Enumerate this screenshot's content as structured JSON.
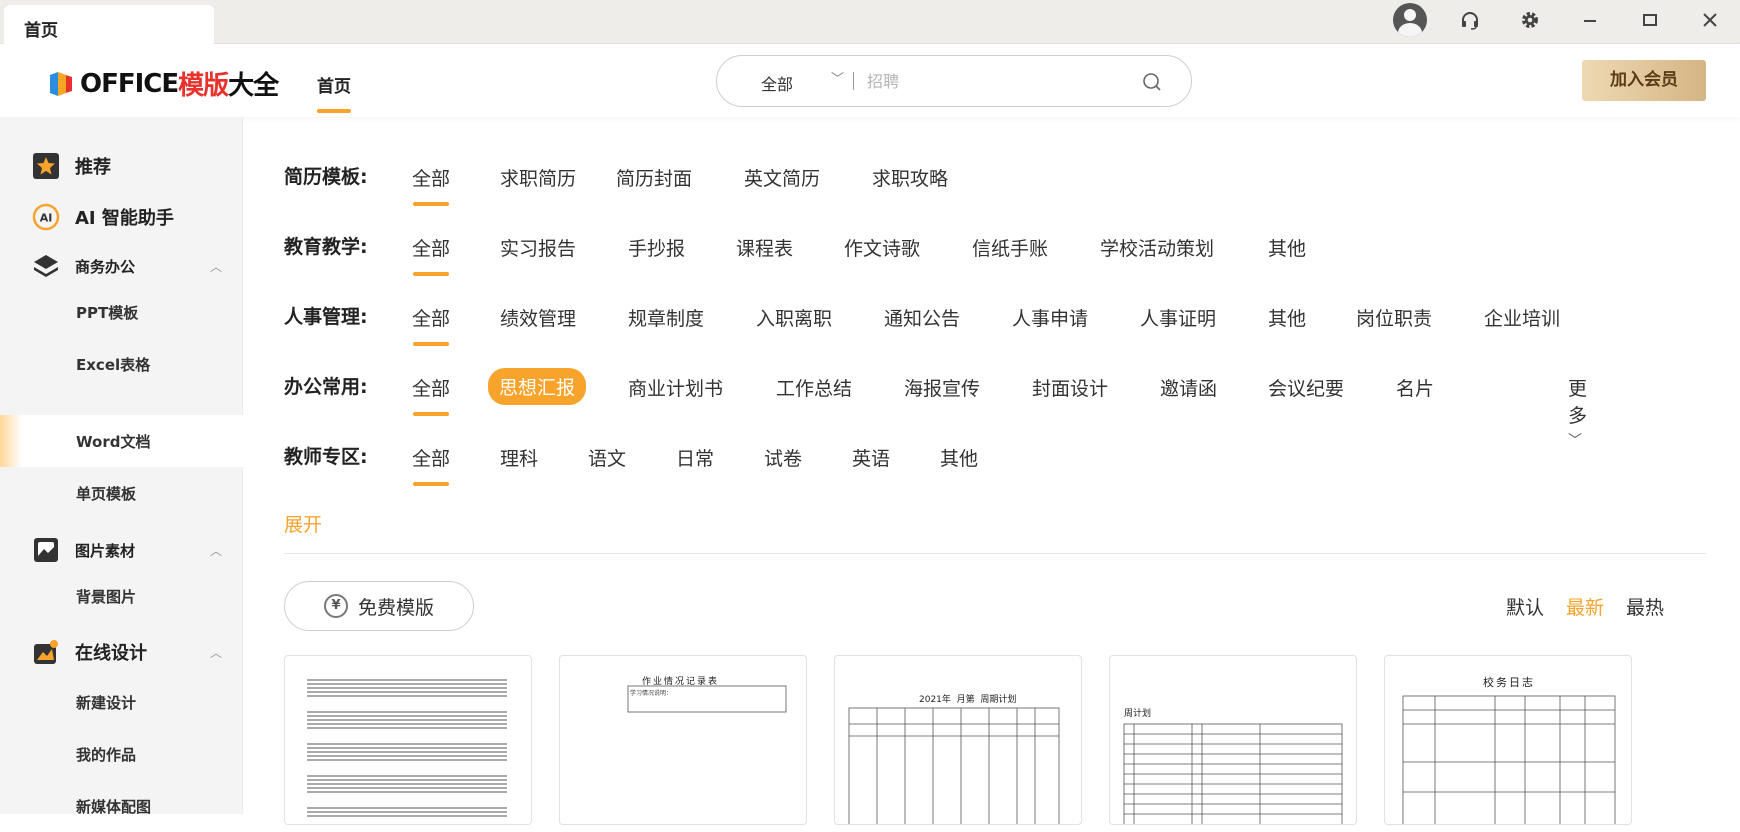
{
  "tab": {
    "title": "首页"
  },
  "window": {
    "buttons": [
      "user-avatar",
      "headset-icon",
      "gear-icon",
      "minimize-icon",
      "maximize-icon",
      "close-icon"
    ]
  },
  "header": {
    "logo_prefix": "OFFICE",
    "logo_red": "模版",
    "logo_suffix": "大全",
    "nav_home": "首页",
    "search_category": "全部",
    "search_placeholder": "招聘",
    "vip_button": "加入会员"
  },
  "sidebar": {
    "recommend": "推荐",
    "ai": "AI 智能助手",
    "business": "商务办公",
    "ppt": "PPT模板",
    "excel": "Excel表格",
    "word": "Word文档",
    "single": "单页模板",
    "images": "图片素材",
    "bg": "背景图片",
    "design": "在线设计",
    "new_design": "新建设计",
    "my_works": "我的作品",
    "new_media": "新媒体配图"
  },
  "filters": [
    {
      "label": "简历模板:",
      "options": [
        "全部",
        "求职简历",
        "简历封面",
        "英文简历",
        "求职攻略"
      ]
    },
    {
      "label": "教育教学:",
      "options": [
        "全部",
        "实习报告",
        "手抄报",
        "课程表",
        "作文诗歌",
        "信纸手账",
        "学校活动策划",
        "其他"
      ]
    },
    {
      "label": "人事管理:",
      "options": [
        "全部",
        "绩效管理",
        "规章制度",
        "入职离职",
        "通知公告",
        "人事申请",
        "人事证明",
        "其他",
        "岗位职责",
        "企业培训"
      ]
    },
    {
      "label": "办公常用:",
      "options": [
        "全部",
        "思想汇报",
        "商业计划书",
        "工作总结",
        "海报宣传",
        "封面设计",
        "邀请函",
        "会议纪要",
        "名片"
      ]
    },
    {
      "label": "教师专区:",
      "options": [
        "全部",
        "理科",
        "语文",
        "日常",
        "试卷",
        "英语",
        "其他"
      ]
    }
  ],
  "more": "更多",
  "expand": "展开",
  "free_button": "免费模版",
  "sort": {
    "default": "默认",
    "newest": "最新",
    "hottest": "最热",
    "active": "最新"
  },
  "cards": [
    {
      "title": ""
    },
    {
      "title": "作业情况记录表",
      "sub": "学习情况说明："
    },
    {
      "title": "2021年  月第  周期计划"
    },
    {
      "title": "周计划"
    },
    {
      "title": "校务日志"
    }
  ],
  "colors": {
    "accent": "#f7a32c",
    "logo_red": "#e8322b",
    "sidebar_bg": "#f4f4f4"
  }
}
